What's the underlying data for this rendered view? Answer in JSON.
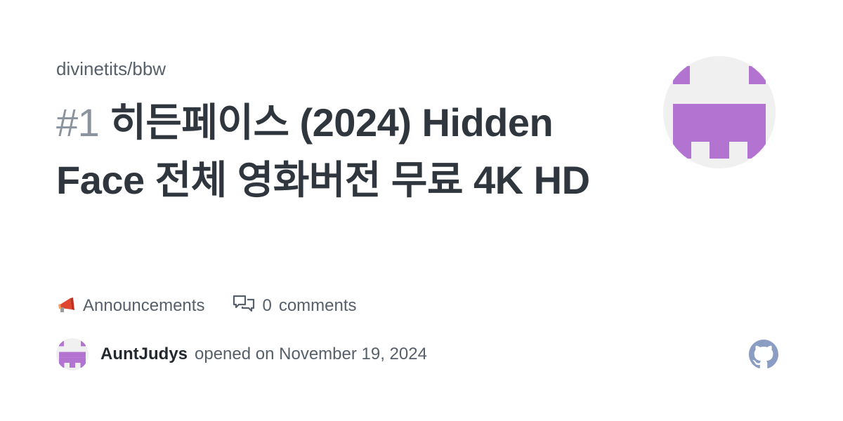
{
  "card": {
    "repo_path": "divinetits/bbw",
    "issue_number": "#1",
    "issue_title": "히든페이스 (2024) Hidden Face 전체 영화버전 무료 4K HD",
    "label": "Announcements",
    "label_icon": "megaphone-icon",
    "comments_icon": "comment-discussion-icon",
    "comment_count": "0",
    "comment_word": "comments",
    "author": "AuntJudys",
    "opened_text": "opened on November 19, 2024",
    "site_logo": "github-logo",
    "avatar_color": "#b274d0",
    "avatar_bg": "#f0f0f0"
  }
}
